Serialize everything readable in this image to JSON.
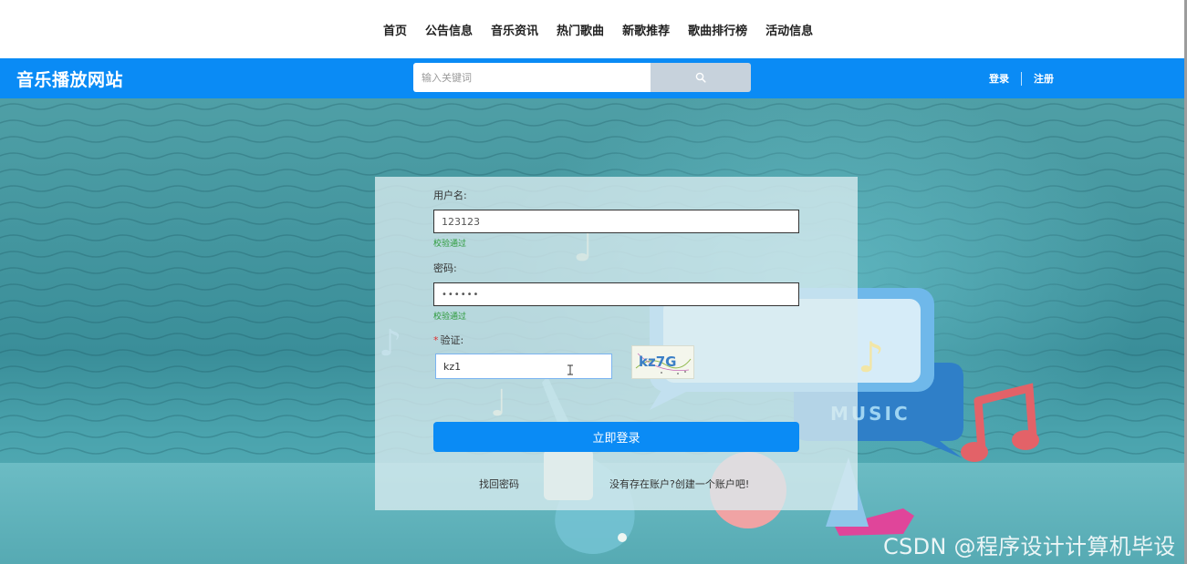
{
  "topnav": {
    "items": [
      "首页",
      "公告信息",
      "音乐资讯",
      "热门歌曲",
      "新歌推荐",
      "歌曲排行榜",
      "活动信息"
    ]
  },
  "header": {
    "site_title": "音乐播放网站",
    "search_placeholder": "输入关键词",
    "search_icon": "search-icon",
    "login_label": "登录",
    "register_label": "注册"
  },
  "login_form": {
    "username_label": "用户名:",
    "username_value": "123123",
    "username_status": "校验通过",
    "password_label": "密码:",
    "password_value": "••••••",
    "password_status": "校验通过",
    "captcha_required_mark": "*",
    "captcha_label": "验证:",
    "captcha_value": "kz1",
    "captcha_image_text": "kz7G",
    "submit_label": "立即登录",
    "forgot_password_label": "找回密码",
    "register_prompt_label": "没有存在账户?创建一个账户吧!"
  },
  "background": {
    "decor_text": "MUSIC"
  },
  "watermark": "CSDN @程序设计计算机毕设",
  "colors": {
    "header_blue": "#0a8bf5",
    "valid_green": "#2c9a3a",
    "background_teal": "#3a8e99"
  }
}
